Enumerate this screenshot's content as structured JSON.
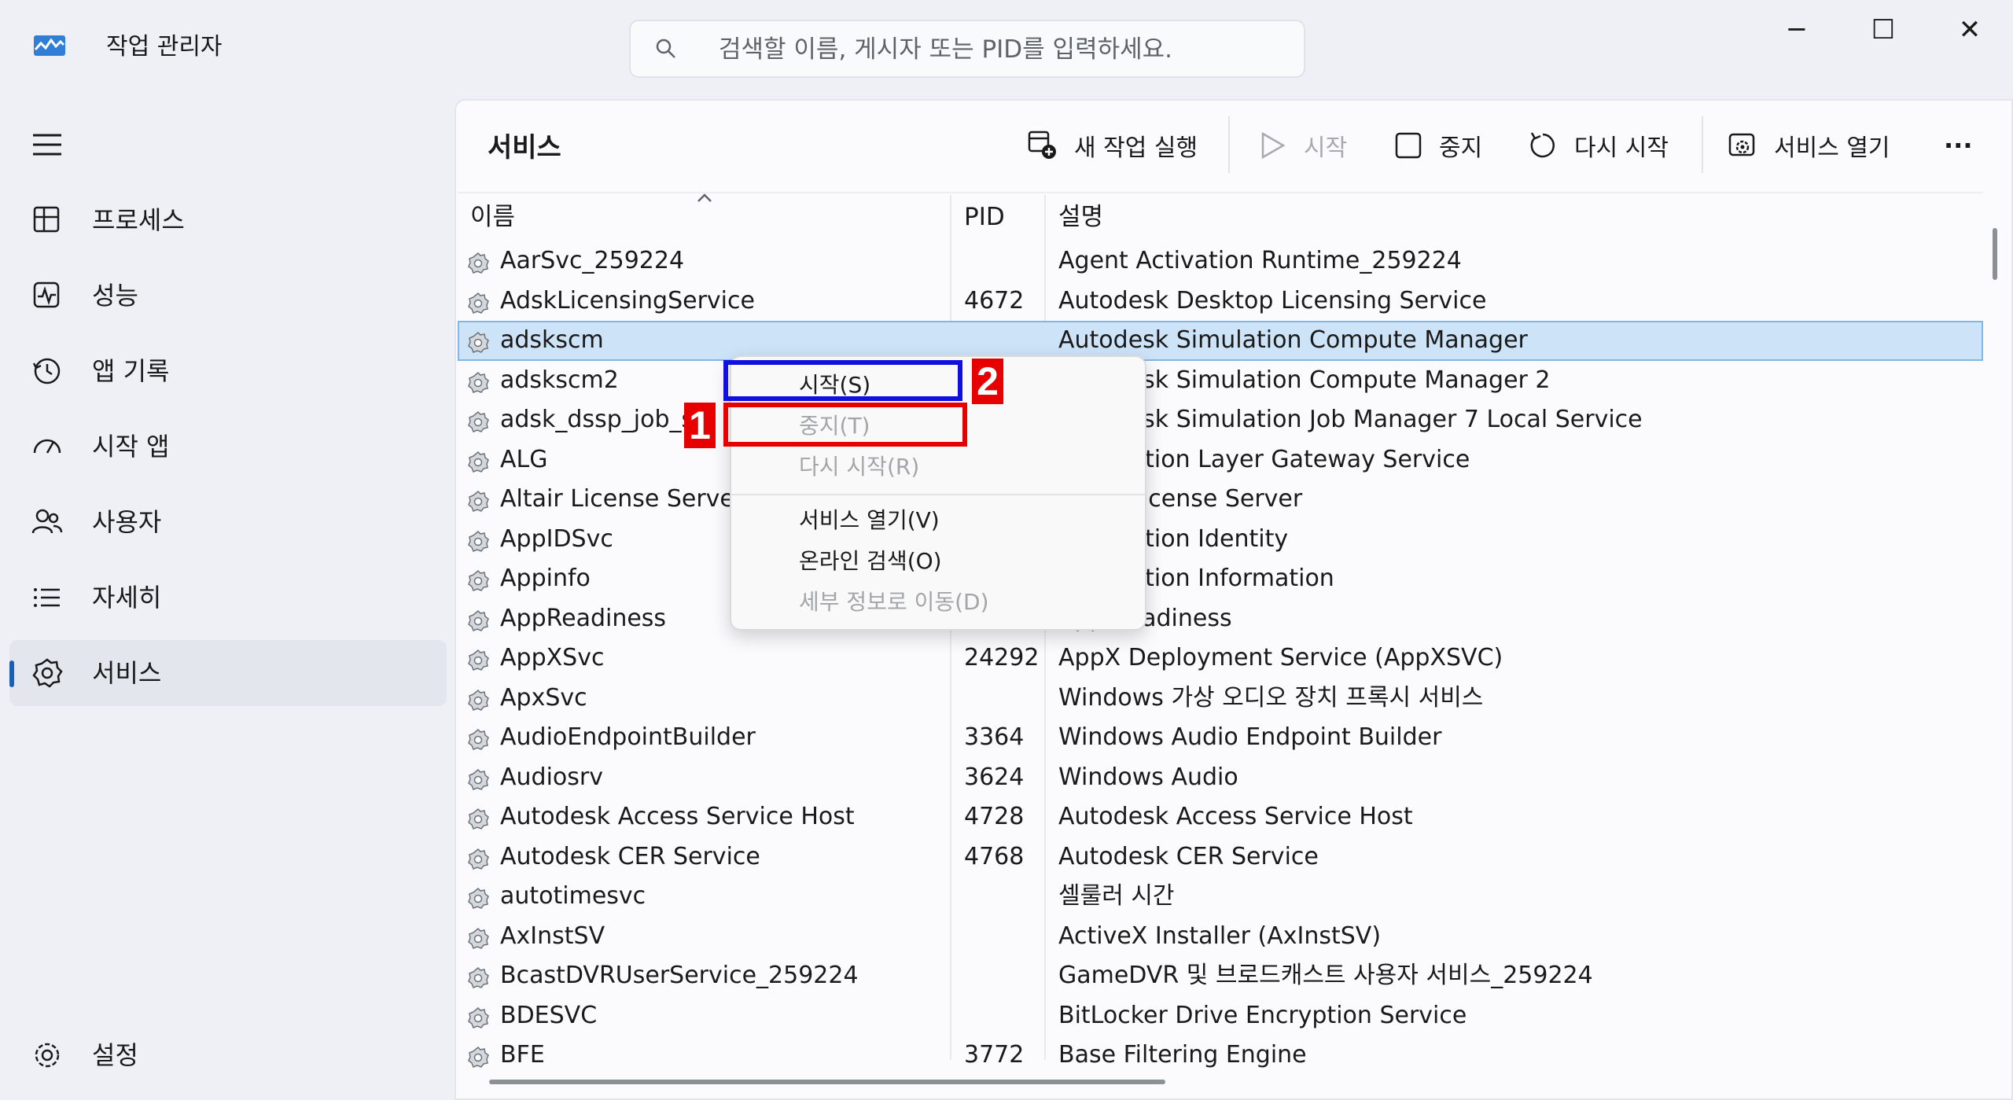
{
  "window": {
    "title": "작업 관리자",
    "minimize": "─",
    "maximize": "☐",
    "close": "✕"
  },
  "search": {
    "placeholder": "검색할 이름, 게시자 또는 PID를 입력하세요."
  },
  "sidebar": {
    "items": [
      {
        "label": "프로세스",
        "icon": "processes-icon"
      },
      {
        "label": "성능",
        "icon": "performance-icon"
      },
      {
        "label": "앱 기록",
        "icon": "history-icon"
      },
      {
        "label": "시작 앱",
        "icon": "startup-icon"
      },
      {
        "label": "사용자",
        "icon": "users-icon"
      },
      {
        "label": "자세히",
        "icon": "details-icon"
      },
      {
        "label": "서비스",
        "icon": "services-icon",
        "active": true
      }
    ],
    "settings": "설정"
  },
  "panel": {
    "title": "서비스"
  },
  "toolbar": {
    "new_task": "새 작업 실행",
    "start": "시작",
    "stop": "중지",
    "restart": "다시 시작",
    "open_services": "서비스 열기",
    "more": "···"
  },
  "table": {
    "columns": [
      "이름",
      "PID",
      "설명"
    ],
    "rows": [
      {
        "name": "AarSvc_259224",
        "pid": "",
        "desc": "Agent Activation Runtime_259224"
      },
      {
        "name": "AdskLicensingService",
        "pid": "4672",
        "desc": "Autodesk Desktop Licensing Service"
      },
      {
        "name": "adskscm",
        "pid": "",
        "desc": "Autodesk Simulation Compute Manager",
        "selected": true
      },
      {
        "name": "adskscm2",
        "pid": "",
        "desc": "Autodesk Simulation Compute Manager 2"
      },
      {
        "name": "adsk_dssp_job_s",
        "pid": "",
        "desc": "Autodesk Simulation Job Manager 7 Local Service"
      },
      {
        "name": "ALG",
        "pid": "",
        "desc": "Application Layer Gateway Service"
      },
      {
        "name": "Altair License Server",
        "pid": "",
        "desc": "Altair License Server"
      },
      {
        "name": "AppIDSvc",
        "pid": "",
        "desc": "Application Identity"
      },
      {
        "name": "Appinfo",
        "pid": "",
        "desc": "Application Information"
      },
      {
        "name": "AppReadiness",
        "pid": "",
        "desc": "App Readiness"
      },
      {
        "name": "AppXSvc",
        "pid": "24292",
        "desc": "AppX Deployment Service (AppXSVC)"
      },
      {
        "name": "ApxSvc",
        "pid": "",
        "desc": "Windows 가상 오디오 장치 프록시 서비스"
      },
      {
        "name": "AudioEndpointBuilder",
        "pid": "3364",
        "desc": "Windows Audio Endpoint Builder"
      },
      {
        "name": "Audiosrv",
        "pid": "3624",
        "desc": "Windows Audio"
      },
      {
        "name": "Autodesk Access Service Host",
        "pid": "4728",
        "desc": "Autodesk Access Service Host"
      },
      {
        "name": "Autodesk CER Service",
        "pid": "4768",
        "desc": "Autodesk CER Service"
      },
      {
        "name": "autotimesvc",
        "pid": "",
        "desc": "셀룰러 시간"
      },
      {
        "name": "AxInstSV",
        "pid": "",
        "desc": "ActiveX Installer (AxInstSV)"
      },
      {
        "name": "BcastDVRUserService_259224",
        "pid": "",
        "desc": "GameDVR 및 브로드캐스트 사용자 서비스_259224"
      },
      {
        "name": "BDESVC",
        "pid": "",
        "desc": "BitLocker Drive Encryption Service"
      },
      {
        "name": "BFE",
        "pid": "3772",
        "desc": "Base Filtering Engine"
      }
    ]
  },
  "context_menu": {
    "start": "시작(S)",
    "stop": "중지(T)",
    "restart": "다시 시작(R)",
    "open_services": "서비스 열기(V)",
    "search_online": "온라인 검색(O)",
    "go_to_details": "세부 정보로 이동(D)"
  },
  "annotations": {
    "badge1": "1",
    "badge2": "2"
  },
  "colors": {
    "accent": "#1a5fb4",
    "selection": "#cde3f7",
    "annotation_red": "#e60000",
    "annotation_blue": "#1010e0"
  }
}
